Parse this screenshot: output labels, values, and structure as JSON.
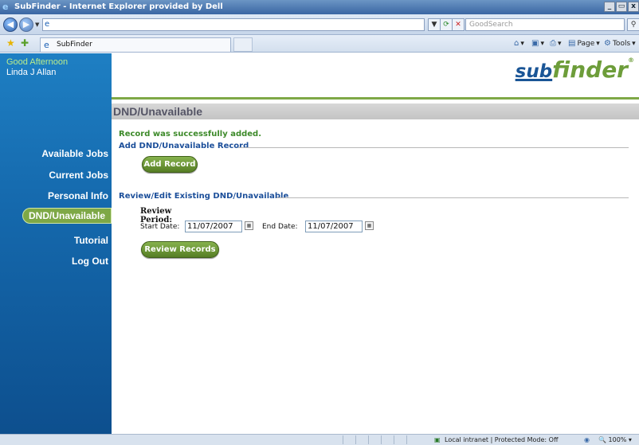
{
  "window": {
    "title": "SubFinder - Internet Explorer provided by Dell",
    "minimize": "_",
    "restore": "▭",
    "close": "x"
  },
  "address": {
    "url": "",
    "search_placeholder": "GoodSearch"
  },
  "tab": {
    "title": "SubFinder"
  },
  "commands": {
    "page": "Page",
    "tools": "Tools"
  },
  "user": {
    "greeting": "Good Afternoon",
    "name": "Linda J Allan"
  },
  "nav": {
    "items": [
      {
        "label": "Available Jobs"
      },
      {
        "label": "Current Jobs"
      },
      {
        "label": "Personal Info"
      },
      {
        "label": "DND/Unavailable",
        "active": true
      },
      {
        "label": "Tutorial"
      },
      {
        "label": "Log Out"
      }
    ]
  },
  "logo": {
    "sub": "sub",
    "finder": "finder",
    "mark": "®"
  },
  "page": {
    "title": "DND/Unavailable",
    "success_message": "Record was successfully added.",
    "add_section_title": "Add DND/Unavailable Record",
    "add_button": "Add Record",
    "review_section_title": "Review/Edit Existing DND/Unavailable",
    "review_period_label": "Review Period:",
    "start_label": "Start Date:",
    "start_value": "11/07/2007",
    "end_label": "End Date:",
    "end_value": "11/07/2007",
    "review_button": "Review Records"
  },
  "status": {
    "zone": "Local intranet | Protected Mode: Off",
    "zoom": "100%"
  },
  "colors": {
    "sidebar": "#1569ad",
    "accent_green": "#7ea846",
    "heading_blue": "#1c4f9a",
    "success_green": "#3d8a2a"
  }
}
